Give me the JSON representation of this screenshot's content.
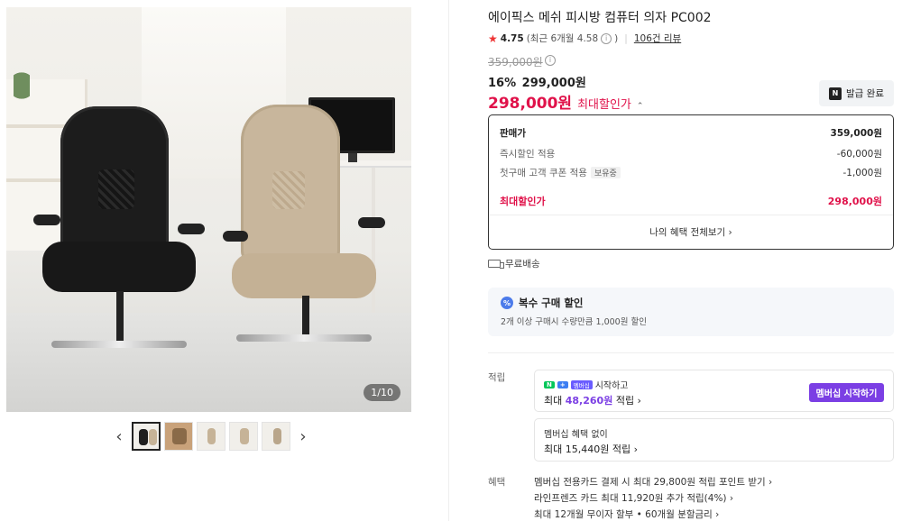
{
  "gallery": {
    "counter": "1/10",
    "prev_label": "‹",
    "next_label": "›",
    "thumb_count": 5
  },
  "product": {
    "title": "에이픽스 메쉬 피시방 컴퓨터 의자 PC002",
    "rating": {
      "score": "4.75",
      "recent": "(최근 6개월 4.58",
      "recent_close": ")",
      "reviews": "106건 리뷰"
    },
    "original_price": "359,000원",
    "discount_pct": "16%",
    "discount_price": "299,000원",
    "final_price": "298,000원",
    "final_label": "최대할인가",
    "issue_button": "발급 완료"
  },
  "price_breakdown": {
    "rows": [
      {
        "label": "판매가",
        "value": "359,000원"
      },
      {
        "label": "즉시할인 적용",
        "value": "-60,000원"
      },
      {
        "label": "첫구매 고객 쿠폰 적용",
        "tag": "보유중",
        "value": "-1,000원"
      },
      {
        "label": "최대할인가",
        "value": "298,000원"
      }
    ],
    "link": "나의 혜택 전체보기 ›"
  },
  "shipping": {
    "label": "무료배송"
  },
  "multi_buy": {
    "title": "복수 구매 할인",
    "desc": "2개 이상 구매시 수량만큼 1,000원 할인"
  },
  "points": {
    "label": "적립",
    "card_a": {
      "badge_n": "N",
      "badge_plus": "+",
      "badge_mem": "멤버십",
      "text": "시작하고",
      "amount_prefix": "최대 ",
      "amount": "48,260원",
      "amount_suffix": " 적립 ›",
      "button": "멤버십 시작하기"
    },
    "card_b": {
      "text": "멤버십 혜택 없이",
      "amount": "최대 15,440원 적립 ›"
    }
  },
  "benefits": {
    "label": "혜택",
    "items": [
      "멤버십 전용카드 결제 시 최대 29,800원 적립 포인트 받기 ›",
      "라인프렌즈 카드 최대 11,920원 추가 적립(4%) ›",
      "최대 12개월 무이자 할부 • 60개월 분할금리 ›"
    ]
  },
  "colors": {
    "accent_red": "#e0124a",
    "membership_purple": "#7b3fe4"
  }
}
